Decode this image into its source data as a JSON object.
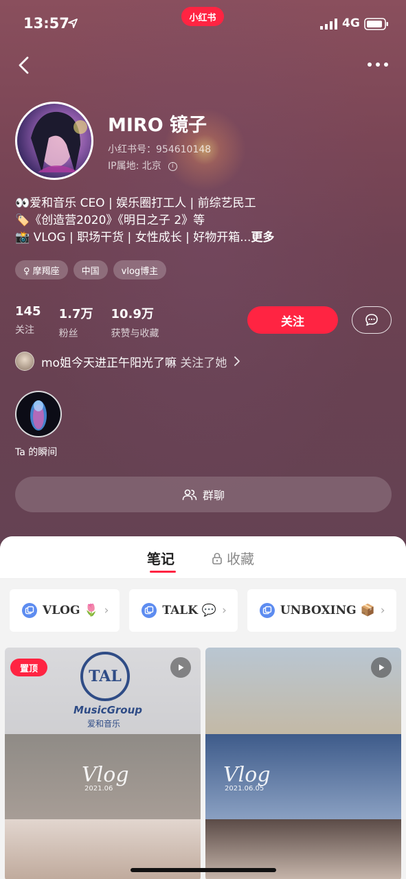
{
  "status_bar": {
    "time": "13:57",
    "network": "4G"
  },
  "app_badge": "小红书",
  "profile": {
    "name": "MIRO 镜子",
    "red_id": "小红书号：954610148",
    "ip_location": "IP属地: 北京",
    "bio": [
      "👀爱和音乐 CEO | 娱乐圈打工人 | 前综艺民工",
      "🏷️《创造营2020》《明日之子 2》等",
      "📸 VLOG | 职场干货 | 女性成长 | 好物开箱..."
    ],
    "bio_more": "更多",
    "tags": [
      "♀ 摩羯座",
      "中国",
      "vlog博主"
    ]
  },
  "stats": [
    {
      "value": "145",
      "label": "关注"
    },
    {
      "value": "1.7万",
      "label": "粉丝"
    },
    {
      "value": "10.9万",
      "label": "获赞与收藏"
    }
  ],
  "actions": {
    "follow": "关注"
  },
  "mutual": {
    "name": "mo姐今天进正午阳光了嘛",
    "suffix": "关注了她"
  },
  "moments": {
    "label": "Ta 的瞬间"
  },
  "group_chat": {
    "label": "群聊"
  },
  "tabs": {
    "notes": "笔记",
    "collections": "收藏"
  },
  "collections": [
    {
      "label": "VLOG 🌷"
    },
    {
      "label": "TALK 💬"
    },
    {
      "label": "UNBOXING 📦"
    }
  ],
  "notes": [
    {
      "badge": "置顶",
      "logo": "TAL",
      "logo_text": "MusicGroup",
      "logo_cn": "爱和音乐",
      "overlay": "Vlog",
      "overlay_date": "2021.06"
    },
    {
      "overlay": "Vlog",
      "overlay_date": "2021.06.05"
    }
  ],
  "colors": {
    "accent": "#ff2442",
    "hero": "#6b4552"
  }
}
